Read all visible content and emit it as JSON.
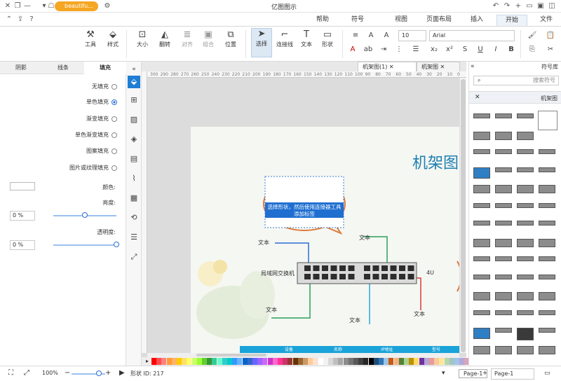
{
  "titlebar": {
    "title": "亿图图示",
    "account": "beautifu..."
  },
  "menu": {
    "items": [
      "文件",
      "开始",
      "插入",
      "页面布局",
      "视图",
      "符号",
      "帮助"
    ]
  },
  "ribbon": {
    "font_name": "Arial",
    "font_size": "10",
    "buttons": {
      "select": "选择",
      "connector": "连接线",
      "text": "文本",
      "shape": "形状",
      "position": "位置",
      "group": "组合",
      "align": "对齐",
      "rotate": "翻转",
      "size": "大小",
      "style": "样式",
      "tools": "工具"
    }
  },
  "left_panel": {
    "tabs": [
      "填充",
      "线条",
      "阴影"
    ],
    "fill_options": [
      "无填充",
      "单色填充",
      "渐变填充",
      "单色渐变填充",
      "图案填充",
      "图片或纹理填充"
    ],
    "selected_fill": "单色填充",
    "color_label": "颜色:",
    "shade_label": "亮度:",
    "shade_value": "0 %",
    "transparency_label": "透明度:",
    "transparency_value": "0 %",
    "slider_value": 0
  },
  "doc_tabs": [
    {
      "label": "机架图(1)",
      "active": true
    },
    {
      "label": "机架图",
      "active": false
    }
  ],
  "ruler": {
    "ticks": [
      "300",
      "290",
      "280",
      "270",
      "260",
      "250",
      "240",
      "230",
      "220",
      "210",
      "200",
      "190",
      "180",
      "170",
      "160",
      "150",
      "140",
      "130",
      "120",
      "110",
      "100",
      "90",
      "80",
      "70",
      "60",
      "50",
      "40",
      "30",
      "20",
      "10",
      "0"
    ]
  },
  "diagram": {
    "title": "机架图",
    "callout_text": "选择形状，然后使用连接器工具添加标签",
    "switch_label": "局域网交换机",
    "unit_label": "4U",
    "labels": [
      "文本",
      "文本",
      "文本",
      "文本",
      "文本"
    ],
    "table_headers": [
      "设备",
      "名称",
      "IP地址",
      "型号"
    ]
  },
  "right_panel": {
    "title": "符号库",
    "search_placeholder": "搜索符号",
    "category": "机架图"
  },
  "palette": {
    "colors": [
      "#ff0000",
      "#ff4d4d",
      "#ff8080",
      "#ff9933",
      "#ffb366",
      "#ffcc00",
      "#ffe066",
      "#ffff66",
      "#ccff66",
      "#99ff33",
      "#66cc33",
      "#339933",
      "#33cc99",
      "#66ffcc",
      "#33cccc",
      "#00cccc",
      "#3399ff",
      "#66b3ff",
      "#0066cc",
      "#3366cc",
      "#6666ff",
      "#9966ff",
      "#cc66ff",
      "#cc33cc",
      "#ff66cc",
      "#ff3399",
      "#cc3366",
      "#993333",
      "#663300",
      "#996633",
      "#cc9966",
      "#ffcc99",
      "#ffe0cc",
      "#ffffff",
      "#f2f2f2",
      "#d9d9d9",
      "#bfbfbf",
      "#a6a6a6",
      "#8c8c8c",
      "#737373",
      "#595959",
      "#404040",
      "#262626",
      "#000000",
      "#1f4e79",
      "#2e75b6",
      "#9dc3e6",
      "#c55a11",
      "#f4b183",
      "#548235",
      "#a9d18e",
      "#bf9000",
      "#ffd966",
      "#7030a0",
      "#b4a7d6",
      "#ea9999",
      "#f9cb9c",
      "#ffe599",
      "#b6d7a8",
      "#a2c4c9",
      "#9fc5e8",
      "#b4a7d6",
      "#d5a6bd",
      "#e06666",
      "#f6b26b",
      "#ffd966",
      "#93c47d",
      "#76a5af",
      "#6fa8dc",
      "#8e7cc3",
      "#c27ba0",
      "#cc0000",
      "#e69138",
      "#f1c232",
      "#6aa84f",
      "#45818e",
      "#3d85c6",
      "#674ea7"
    ],
    "accent": "#1f7ed4"
  },
  "status": {
    "page_selector": "Page-1",
    "page_tab": "Page-1",
    "shape_id": "形状 ID: 217",
    "zoom": "100%"
  }
}
